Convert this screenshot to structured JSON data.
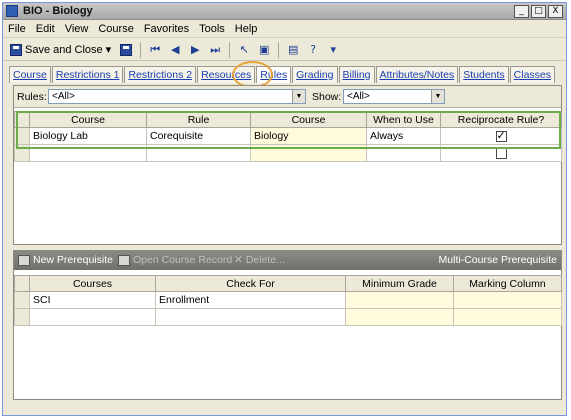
{
  "window": {
    "title": "BIO - Biology",
    "min": "_",
    "max": "□",
    "close": "X"
  },
  "menu": [
    "File",
    "Edit",
    "View",
    "Course",
    "Favorites",
    "Tools",
    "Help"
  ],
  "toolbar": {
    "save_close": "Save and Close",
    "dropdown": "▾",
    "help": "?"
  },
  "tabs": [
    "Course",
    "Restrictions 1",
    "Restrictions 2",
    "Resources",
    "Rules",
    "Grading",
    "Billing",
    "Attributes/Notes",
    "Students",
    "Classes"
  ],
  "active_tab": "Rules",
  "filters": {
    "rules_label": "Rules:",
    "rules_value": "<All>",
    "show_label": "Show:",
    "show_value": "<All>"
  },
  "rules_table": {
    "headers": [
      "Course",
      "Rule",
      "Course",
      "When to Use",
      "Reciprocate Rule?"
    ],
    "rows": [
      {
        "course": "Biology Lab",
        "rule": "Corequisite",
        "course2": "Biology",
        "when": "Always",
        "reciprocate": true
      },
      {
        "course": "",
        "rule": "",
        "course2": "",
        "when": "",
        "reciprocate": false
      }
    ]
  },
  "bottom_toolbar": {
    "new_prereq": "New Prerequisite",
    "open_record": "Open Course Record",
    "delete": "Delete...",
    "multi": "Multi-Course Prerequisite"
  },
  "prereq_table": {
    "headers": [
      "Courses",
      "Check For",
      "Minimum Grade",
      "Marking Column"
    ],
    "rows": [
      {
        "courses": "SCI",
        "check": "Enrollment",
        "min": "",
        "mark": ""
      },
      {
        "courses": "",
        "check": "",
        "min": "",
        "mark": ""
      }
    ]
  },
  "colors": {
    "tab_highlight": "#e8a33c",
    "row_highlight": "#6cac4a",
    "link": "#1a3fb0"
  }
}
